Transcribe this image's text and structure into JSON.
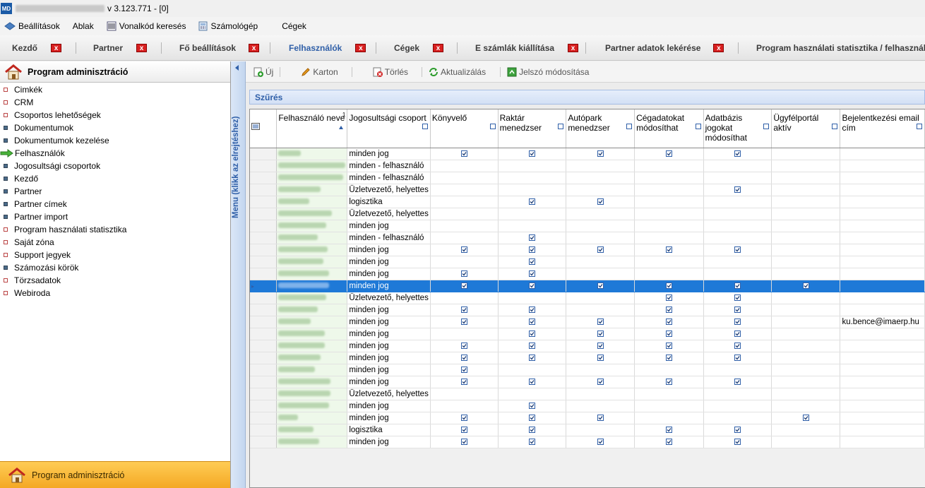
{
  "title": {
    "version": "v 3.123.771 - [0]"
  },
  "menu": [
    {
      "label": "Beállítások",
      "icon": "settings-icon"
    },
    {
      "label": "Ablak",
      "icon": ""
    },
    {
      "label": "Vonalkód keresés",
      "icon": "barcode-icon"
    },
    {
      "label": "Számológép",
      "icon": "calculator-icon"
    },
    {
      "label": "Cégek",
      "icon": ""
    }
  ],
  "tabs": [
    {
      "label": "Kezdő",
      "active": false
    },
    {
      "label": "Partner",
      "active": false
    },
    {
      "label": "Fő beállítások",
      "active": false
    },
    {
      "label": "Felhasználók",
      "active": true
    },
    {
      "label": "Cégek",
      "active": false
    },
    {
      "label": "E számlák kiállítása",
      "active": false
    },
    {
      "label": "Partner adatok lekérése",
      "active": false
    },
    {
      "label": "Program használati statisztika / felhasználó",
      "active": false
    }
  ],
  "tab_close": "x",
  "sidebar": {
    "header": "Program adminisztráció",
    "items": [
      {
        "label": "Cimkék",
        "style": "light"
      },
      {
        "label": "CRM",
        "style": "light"
      },
      {
        "label": "Csoportos lehetőségek",
        "style": "light"
      },
      {
        "label": "Dokumentumok",
        "style": "dark"
      },
      {
        "label": "Dokumentumok kezelése",
        "style": "dark"
      },
      {
        "label": "Felhasználók",
        "style": "arrow"
      },
      {
        "label": "Jogosultsági csoportok",
        "style": "dark"
      },
      {
        "label": "Kezdő",
        "style": "dark"
      },
      {
        "label": "Partner",
        "style": "dark"
      },
      {
        "label": "Partner címek",
        "style": "dark"
      },
      {
        "label": "Partner import",
        "style": "dark"
      },
      {
        "label": "Program használati statisztika",
        "style": "light"
      },
      {
        "label": "Saját zóna",
        "style": "light"
      },
      {
        "label": "Support jegyek",
        "style": "light"
      },
      {
        "label": "Számozási körök",
        "style": "dark"
      },
      {
        "label": "Törzsadatok",
        "style": "light"
      },
      {
        "label": "Webiroda",
        "style": "light"
      }
    ],
    "footer": "Program adminisztráció",
    "collapse_label": "Menu (klikk az elrejtéshez)"
  },
  "toolbar": {
    "new": "Új",
    "card": "Karton",
    "delete": "Törlés",
    "refresh": "Aktualizálás",
    "password": "Jelszó módosítása"
  },
  "filter": {
    "label": "Szűrés"
  },
  "grid": {
    "sort_index": "1",
    "columns": [
      "Felhasználó neve",
      "Jogosultsági csoport",
      "Könyvelő",
      "Raktár menedzser",
      "Autópark menedzser",
      "Cégadatokat módosíthat",
      "Adatbázis jogokat módosíthat",
      "Ügyfélportál aktív",
      "Bejelentkezési email cím"
    ],
    "selected_row": 11,
    "rows": [
      {
        "w": 32,
        "group": "minden jog",
        "flags": [
          1,
          1,
          1,
          1,
          1,
          0
        ],
        "email": ""
      },
      {
        "w": 95,
        "group": "minden - felhasználó",
        "flags": [
          0,
          0,
          0,
          0,
          0,
          0
        ],
        "email": ""
      },
      {
        "w": 92,
        "group": "minden - felhasználó",
        "flags": [
          0,
          0,
          0,
          0,
          0,
          0
        ],
        "email": ""
      },
      {
        "w": 60,
        "group": "Üzletvezető, helyettes",
        "flags": [
          0,
          0,
          0,
          0,
          1,
          0
        ],
        "email": ""
      },
      {
        "w": 44,
        "group": "logisztika",
        "flags": [
          0,
          1,
          1,
          0,
          0,
          0
        ],
        "email": ""
      },
      {
        "w": 76,
        "group": "Üzletvezető, helyettes",
        "flags": [
          0,
          0,
          0,
          0,
          0,
          0
        ],
        "email": ""
      },
      {
        "w": 68,
        "group": "minden jog",
        "flags": [
          0,
          0,
          0,
          0,
          0,
          0
        ],
        "email": ""
      },
      {
        "w": 56,
        "group": "minden - felhasználó",
        "flags": [
          0,
          1,
          0,
          0,
          0,
          0
        ],
        "email": ""
      },
      {
        "w": 70,
        "group": "minden jog",
        "flags": [
          1,
          1,
          1,
          1,
          1,
          0
        ],
        "email": ""
      },
      {
        "w": 64,
        "group": "minden jog",
        "flags": [
          0,
          1,
          0,
          0,
          0,
          0
        ],
        "email": ""
      },
      {
        "w": 72,
        "group": "minden jog",
        "flags": [
          1,
          1,
          0,
          0,
          0,
          0
        ],
        "email": ""
      },
      {
        "w": 72,
        "group": "minden jog",
        "flags": [
          1,
          1,
          1,
          1,
          1,
          1
        ],
        "email": ""
      },
      {
        "w": 68,
        "group": "Üzletvezető, helyettes",
        "flags": [
          0,
          0,
          0,
          1,
          1,
          0
        ],
        "email": ""
      },
      {
        "w": 56,
        "group": "minden jog",
        "flags": [
          1,
          1,
          0,
          1,
          1,
          0
        ],
        "email": ""
      },
      {
        "w": 46,
        "group": "minden jog",
        "flags": [
          1,
          1,
          1,
          1,
          1,
          0
        ],
        "email": "ku.bence@imaerp.hu"
      },
      {
        "w": 66,
        "group": "minden jog",
        "flags": [
          0,
          1,
          1,
          1,
          1,
          0
        ],
        "email": ""
      },
      {
        "w": 66,
        "group": "minden jog",
        "flags": [
          1,
          1,
          1,
          1,
          1,
          0
        ],
        "email": ""
      },
      {
        "w": 60,
        "group": "minden jog",
        "flags": [
          1,
          1,
          1,
          1,
          1,
          0
        ],
        "email": ""
      },
      {
        "w": 52,
        "group": "minden jog",
        "flags": [
          1,
          0,
          0,
          0,
          0,
          0
        ],
        "email": ""
      },
      {
        "w": 74,
        "group": "minden jog",
        "flags": [
          1,
          1,
          1,
          1,
          1,
          0
        ],
        "email": ""
      },
      {
        "w": 74,
        "group": "Üzletvezető, helyettes",
        "flags": [
          0,
          0,
          0,
          0,
          0,
          0
        ],
        "email": ""
      },
      {
        "w": 72,
        "group": "minden jog",
        "flags": [
          0,
          1,
          0,
          0,
          0,
          0
        ],
        "email": ""
      },
      {
        "w": 28,
        "group": "minden jog",
        "flags": [
          1,
          1,
          1,
          0,
          0,
          1
        ],
        "email": ""
      },
      {
        "w": 50,
        "group": "logisztika",
        "flags": [
          1,
          1,
          0,
          1,
          1,
          0
        ],
        "email": ""
      },
      {
        "w": 58,
        "group": "minden jog",
        "flags": [
          1,
          1,
          1,
          1,
          1,
          0
        ],
        "email": ""
      }
    ]
  }
}
